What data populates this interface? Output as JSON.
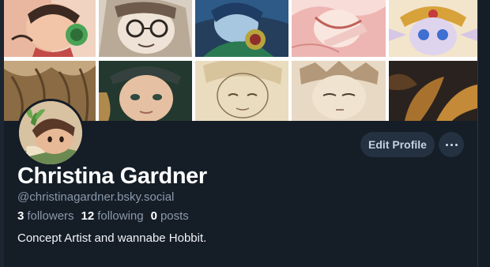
{
  "profile": {
    "display_name": "Christina Gardner",
    "handle": "@christinagardner.bsky.social",
    "bio": "Concept Artist and wannabe Hobbit.",
    "stats": {
      "followers_count": "3",
      "followers_label": "followers",
      "following_count": "12",
      "following_label": "following",
      "posts_count": "0",
      "posts_label": "posts"
    }
  },
  "actions": {
    "edit_profile_label": "Edit Profile",
    "more_icon": "ellipsis-horizontal-icon"
  },
  "banner": {
    "tiles": [
      "girl-with-headphones-art",
      "girl-with-glasses-sketch",
      "blue-haired-girl-art",
      "pink-hair-character-art",
      "elf-with-jewels-art",
      "tangled-hair-sketch",
      "girl-with-beret-art",
      "girl-portrait-sketch",
      "boy-face-sketch",
      "dark-leaves-art"
    ]
  },
  "colors": {
    "background": "#151d27",
    "button_bg": "#243140",
    "muted_text": "#8a99ab",
    "primary_text": "#ffffff"
  }
}
